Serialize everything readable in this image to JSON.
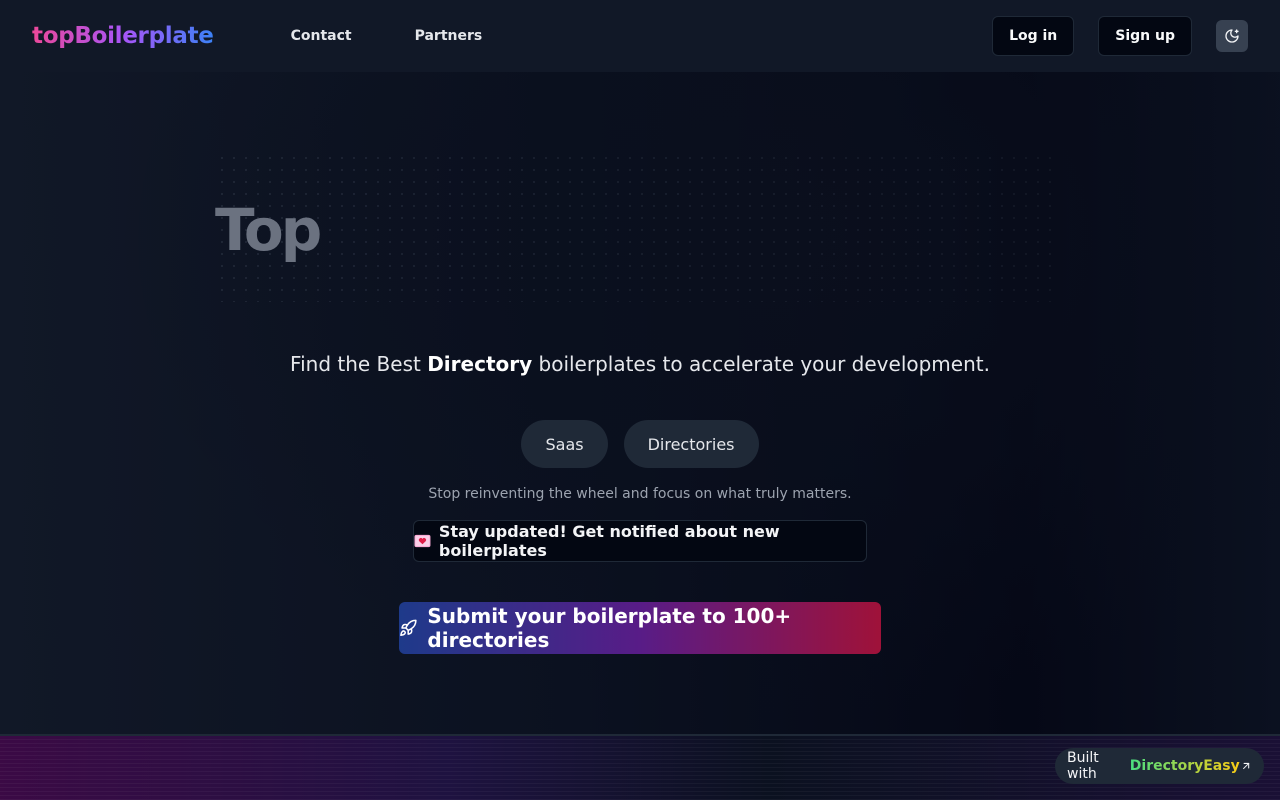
{
  "header": {
    "logo": "topBoilerplate",
    "nav": [
      {
        "label": "Contact"
      },
      {
        "label": "Partners"
      }
    ],
    "login_label": "Log in",
    "signup_label": "Sign up",
    "theme_icon": "moon-icon"
  },
  "hero": {
    "big_title": "Top",
    "tagline_prefix": "Find the Best ",
    "tagline_bold": "Directory",
    "tagline_suffix": " boilerplates to accelerate your development.",
    "pills": [
      {
        "label": "Saas"
      },
      {
        "label": "Directories"
      }
    ],
    "subtitle": "Stop reinventing the wheel and focus on what truly matters.",
    "notify_label": "Stay updated! Get notified about new boilerplates",
    "notify_icon": "love-letter-icon",
    "submit_label": "Submit your boilerplate to 100+ directories",
    "submit_icon": "rocket-icon"
  },
  "footer": {
    "built_prefix": "Built with",
    "built_brand": "DirectoryEasy",
    "built_icon": "arrow-up-right-icon"
  },
  "colors": {
    "background": "#0b1120",
    "header": "#111827",
    "pill": "#1f2937",
    "logo_gradient": [
      "#ec4899",
      "#a855f7",
      "#3b82f6"
    ],
    "submit_gradient": [
      "#1e3a8a",
      "#581c87",
      "#9f1239"
    ],
    "brand_gradient": [
      "#4ade80",
      "#facc15"
    ]
  }
}
